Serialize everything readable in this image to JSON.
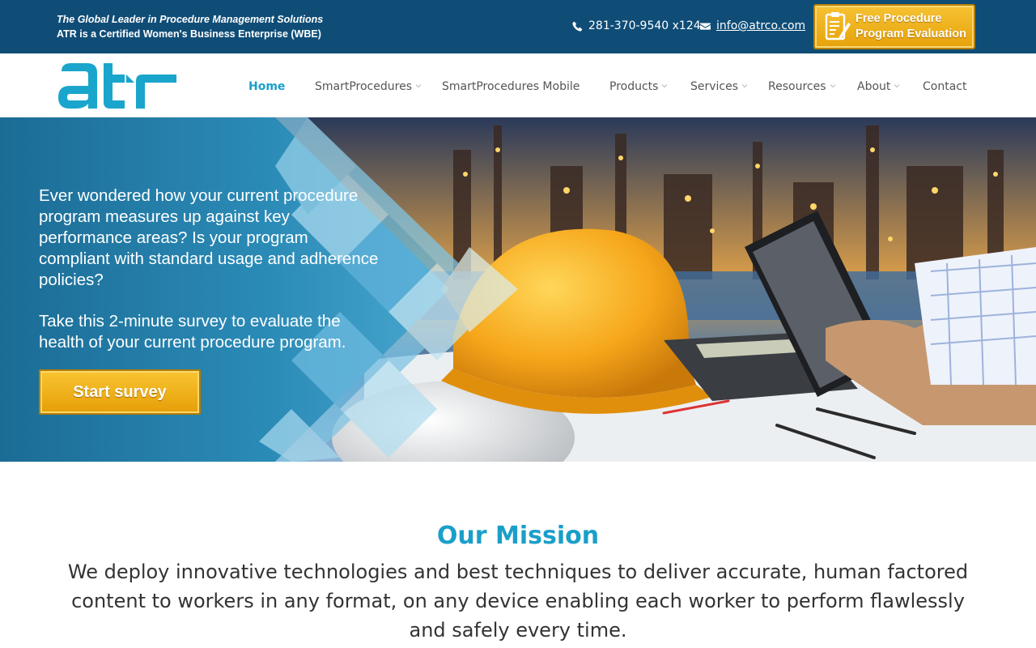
{
  "header": {
    "tagline_1": "The Global Leader in Procedure Management Solutions",
    "tagline_2": "ATR is a Certified Women's Business Enterprise (WBE)",
    "phone": "281-370-9540 x124",
    "email": "info@atrco.com",
    "cta_line_1": "Free Procedure",
    "cta_line_2": "Program Evaluation",
    "background": "#0f4d77"
  },
  "nav": {
    "logo_alt": "atr",
    "items": [
      {
        "label": "Home",
        "active": true,
        "has_dropdown": false
      },
      {
        "label": "SmartProcedures",
        "active": false,
        "has_dropdown": true
      },
      {
        "label": "SmartProcedures Mobile",
        "active": false,
        "has_dropdown": false
      },
      {
        "label": "Products",
        "active": false,
        "has_dropdown": true
      },
      {
        "label": "Services",
        "active": false,
        "has_dropdown": true
      },
      {
        "label": "Resources",
        "active": false,
        "has_dropdown": true
      },
      {
        "label": "About",
        "active": false,
        "has_dropdown": true
      },
      {
        "label": "Contact",
        "active": false,
        "has_dropdown": false
      }
    ],
    "accent": "#1a9fc9"
  },
  "hero": {
    "paragraph_1": "Ever wondered how your current procedure program measures up against key performance areas? Is your program compliant with standard usage and adherence policies?",
    "paragraph_2": "Take this 2-minute survey to evaluate the health of your current procedure program.",
    "button": "Start survey"
  },
  "mission": {
    "title": "Our Mission",
    "text": "We deploy innovative technologies and best techniques to deliver accurate, human factored content to workers in any format, on any device enabling each worker to perform flawlessly and safely every time."
  }
}
